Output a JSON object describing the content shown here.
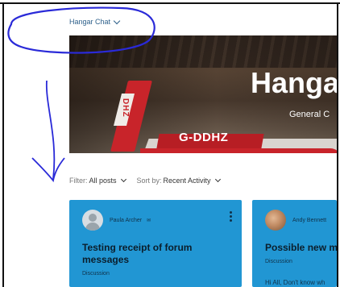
{
  "forum": {
    "name": "Hangar Chat"
  },
  "banner": {
    "title": "Hangar",
    "subtitle": "General C",
    "registration": "G-DDHZ",
    "tail_text": "DHZ"
  },
  "filters": {
    "filter_label": "Filter:",
    "filter_value": "All posts",
    "sort_label": "Sort by:",
    "sort_value": "Recent Activity"
  },
  "posts": [
    {
      "author": "Paula Archer",
      "badge": "✉",
      "title": "Testing receipt of forum messages",
      "tag": "Discussion",
      "preview": ""
    },
    {
      "author": "Andy Bennett",
      "badge": "",
      "title": "Possible new me",
      "tag": "Discussion",
      "preview": "Hi All, Don't know wh"
    }
  ],
  "colors": {
    "card": "#2196d3",
    "link": "#2c5f8a",
    "aircraft": "#c8242a",
    "annotation": "#2a2ad8"
  },
  "icons": {
    "dropdown": "chevron-down-icon",
    "menu": "more-vertical-icon",
    "avatar": "user-avatar-icon"
  }
}
